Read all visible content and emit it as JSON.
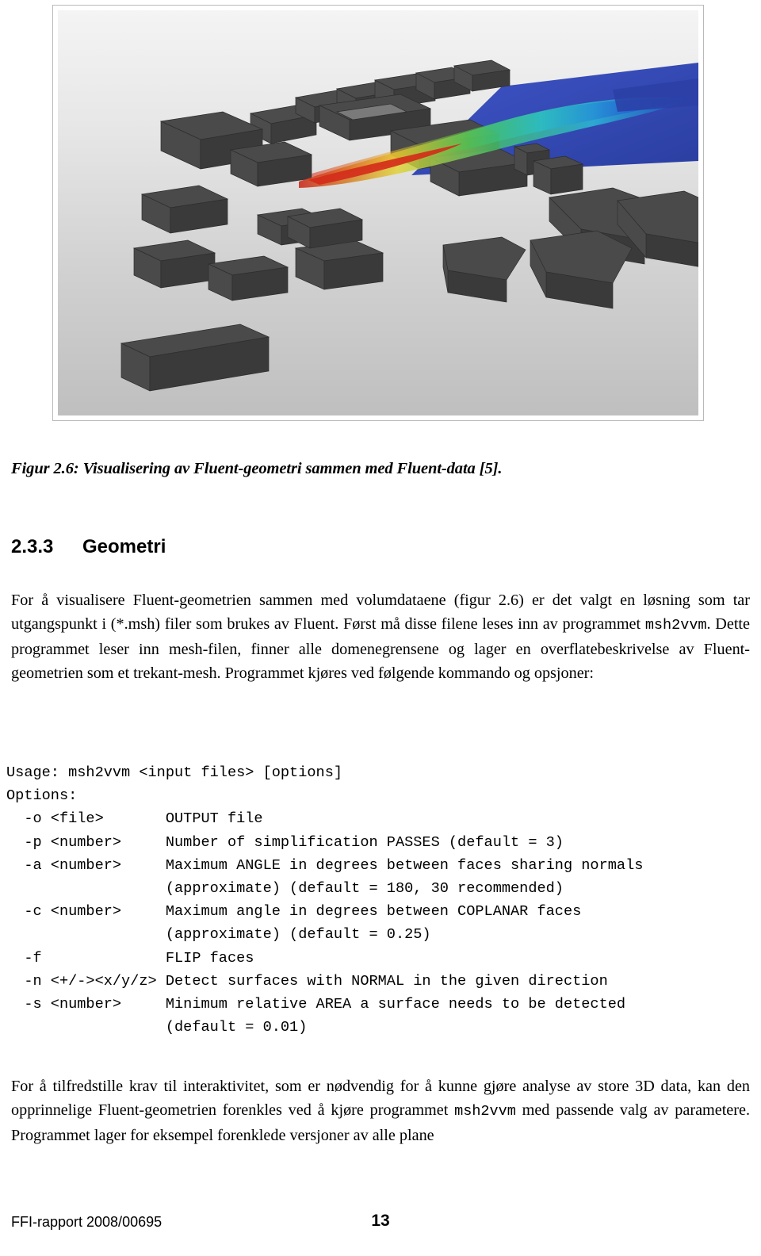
{
  "figure": {
    "alt_name": "fluent-geometry-visualization",
    "background_top": "#f2f2f2",
    "background_bottom": "#c2c2c2",
    "building_color": "#4a4a4a",
    "plane_color": "#3a4fb5",
    "plume_colors": [
      "#1f4fd8",
      "#19c3d6",
      "#33cc55",
      "#e8e83a",
      "#e03020"
    ]
  },
  "caption": {
    "text": "Figur 2.6: Visualisering av Fluent-geometri sammen med Fluent-data [5]."
  },
  "section": {
    "number": "2.3.3",
    "title": "Geometri"
  },
  "paragraphs": {
    "p1_a": "For å visualisere Fluent-geometrien sammen med volumdataene (figur 2.6) er det valgt en løsning som tar utgangspunkt i (*.msh) filer som brukes av Fluent. Først må disse filene leses inn av programmet ",
    "p1_mono": "msh2vvm",
    "p1_b": ". Dette programmet leser inn mesh-filen, finner alle domenegrensene og lager en overflatebeskrivelse av Fluent-geometrien som et trekant-mesh. Programmet kjøres ved følgende kommando og opsjoner:",
    "p2_a": "For å tilfredstille krav til interaktivitet, som er nødvendig for å kunne gjøre analyse av store 3D data, kan den opprinnelige Fluent-geometrien forenkles ved å kjøre programmet ",
    "p2_mono": "msh2vvm",
    "p2_b": " med passende valg av parametere. Programmet lager for eksempel forenklede versjoner av alle plane"
  },
  "usage_block": {
    "text": "Usage: msh2vvm <input files> [options]\nOptions:\n  -o <file>       OUTPUT file\n  -p <number>     Number of simplification PASSES (default = 3)\n  -a <number>     Maximum ANGLE in degrees between faces sharing normals\n                  (approximate) (default = 180, 30 recommended)\n  -c <number>     Maximum angle in degrees between COPLANAR faces\n                  (approximate) (default = 0.25)\n  -f              FLIP faces\n  -n <+/-><x/y/z> Detect surfaces with NORMAL in the given direction\n  -s <number>     Minimum relative AREA a surface needs to be detected\n                  (default = 0.01)"
  },
  "footer": {
    "report_id": "FFI-rapport 2008/00695",
    "page_number": "13"
  }
}
